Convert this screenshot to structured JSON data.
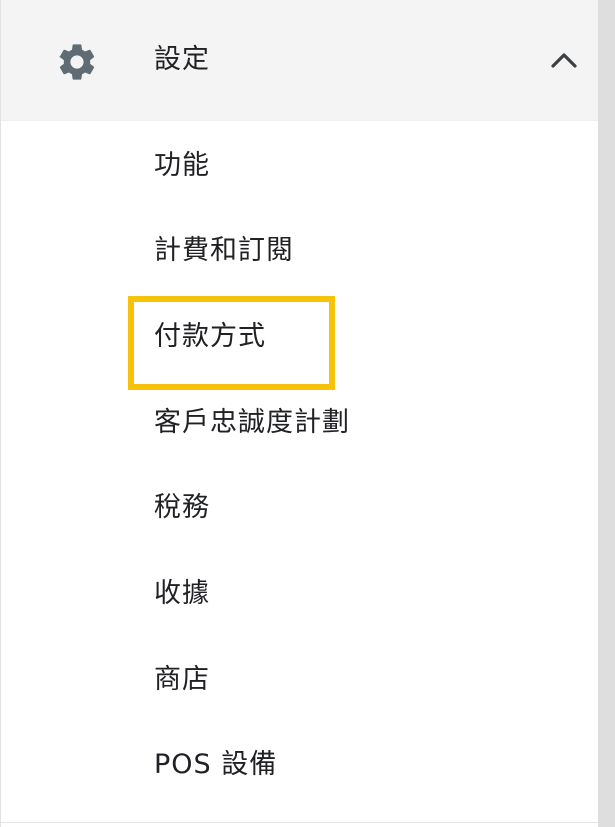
{
  "header": {
    "title": "設定",
    "icon": "gear-icon",
    "toggle_icon": "chevron-up-icon"
  },
  "menu": {
    "items": [
      {
        "label": "功能"
      },
      {
        "label": "計費和訂閱"
      },
      {
        "label": "付款方式"
      },
      {
        "label": "客戶忠誠度計劃"
      },
      {
        "label": "稅務"
      },
      {
        "label": "收據"
      },
      {
        "label": "商店"
      },
      {
        "label": "POS 設備"
      }
    ]
  },
  "colors": {
    "header_bg": "#f4f4f4",
    "icon": "#5f6c74",
    "highlight": "#f8c20a",
    "text": "#202124"
  }
}
